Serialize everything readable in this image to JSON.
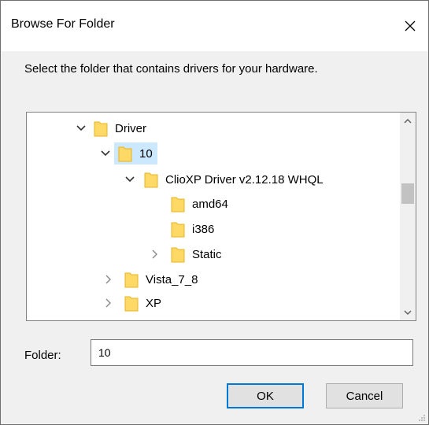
{
  "dialog": {
    "title": "Browse For Folder",
    "prompt": "Select the folder that contains drivers for your hardware."
  },
  "tree": {
    "items": [
      {
        "label": "Driver",
        "state": "expanded"
      },
      {
        "label": "10",
        "state": "expanded",
        "selected": true
      },
      {
        "label": "ClioXP Driver v2.12.18 WHQL",
        "state": "expanded"
      },
      {
        "label": "amd64",
        "state": "leaf"
      },
      {
        "label": "i386",
        "state": "leaf"
      },
      {
        "label": "Static",
        "state": "collapsed"
      },
      {
        "label": "Vista_7_8",
        "state": "collapsed"
      },
      {
        "label": "XP",
        "state": "collapsed"
      }
    ]
  },
  "folder": {
    "label": "Folder:",
    "value": "10"
  },
  "buttons": {
    "ok": "OK",
    "cancel": "Cancel"
  },
  "colors": {
    "selection": "#cce8ff",
    "folder_fill": "#ffd966",
    "accent": "#0078d7"
  }
}
